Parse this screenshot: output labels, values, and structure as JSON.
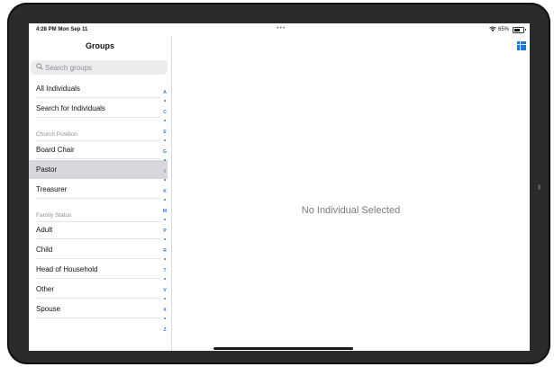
{
  "status_bar": {
    "time": "4:28 PM  Mon Sep 11",
    "dots": "•••",
    "battery": "65%"
  },
  "sidebar": {
    "title": "Groups",
    "search_placeholder": "Search groups",
    "top_items": [
      "All Individuals",
      "Search for Individuals"
    ],
    "sections": [
      {
        "header": "Church Position",
        "items": [
          "Board Chair",
          "Pastor",
          "Treasurer"
        ]
      },
      {
        "header": "Family Status",
        "items": [
          "Adult",
          "Child",
          "Head of Household",
          "Other",
          "Spouse"
        ]
      }
    ],
    "selected_item": "Pastor",
    "index_letters": [
      "A",
      "C",
      "E",
      "G",
      "I",
      "K",
      "M",
      "P",
      "R",
      "T",
      "V",
      "X",
      "Z"
    ]
  },
  "detail": {
    "empty_message": "No Individual Selected",
    "grid_icon": "apps-grid-icon"
  },
  "colors": {
    "accent": "#1e72d9",
    "selected_row": "#d8d8dc",
    "frame": "#2b2b2d"
  }
}
